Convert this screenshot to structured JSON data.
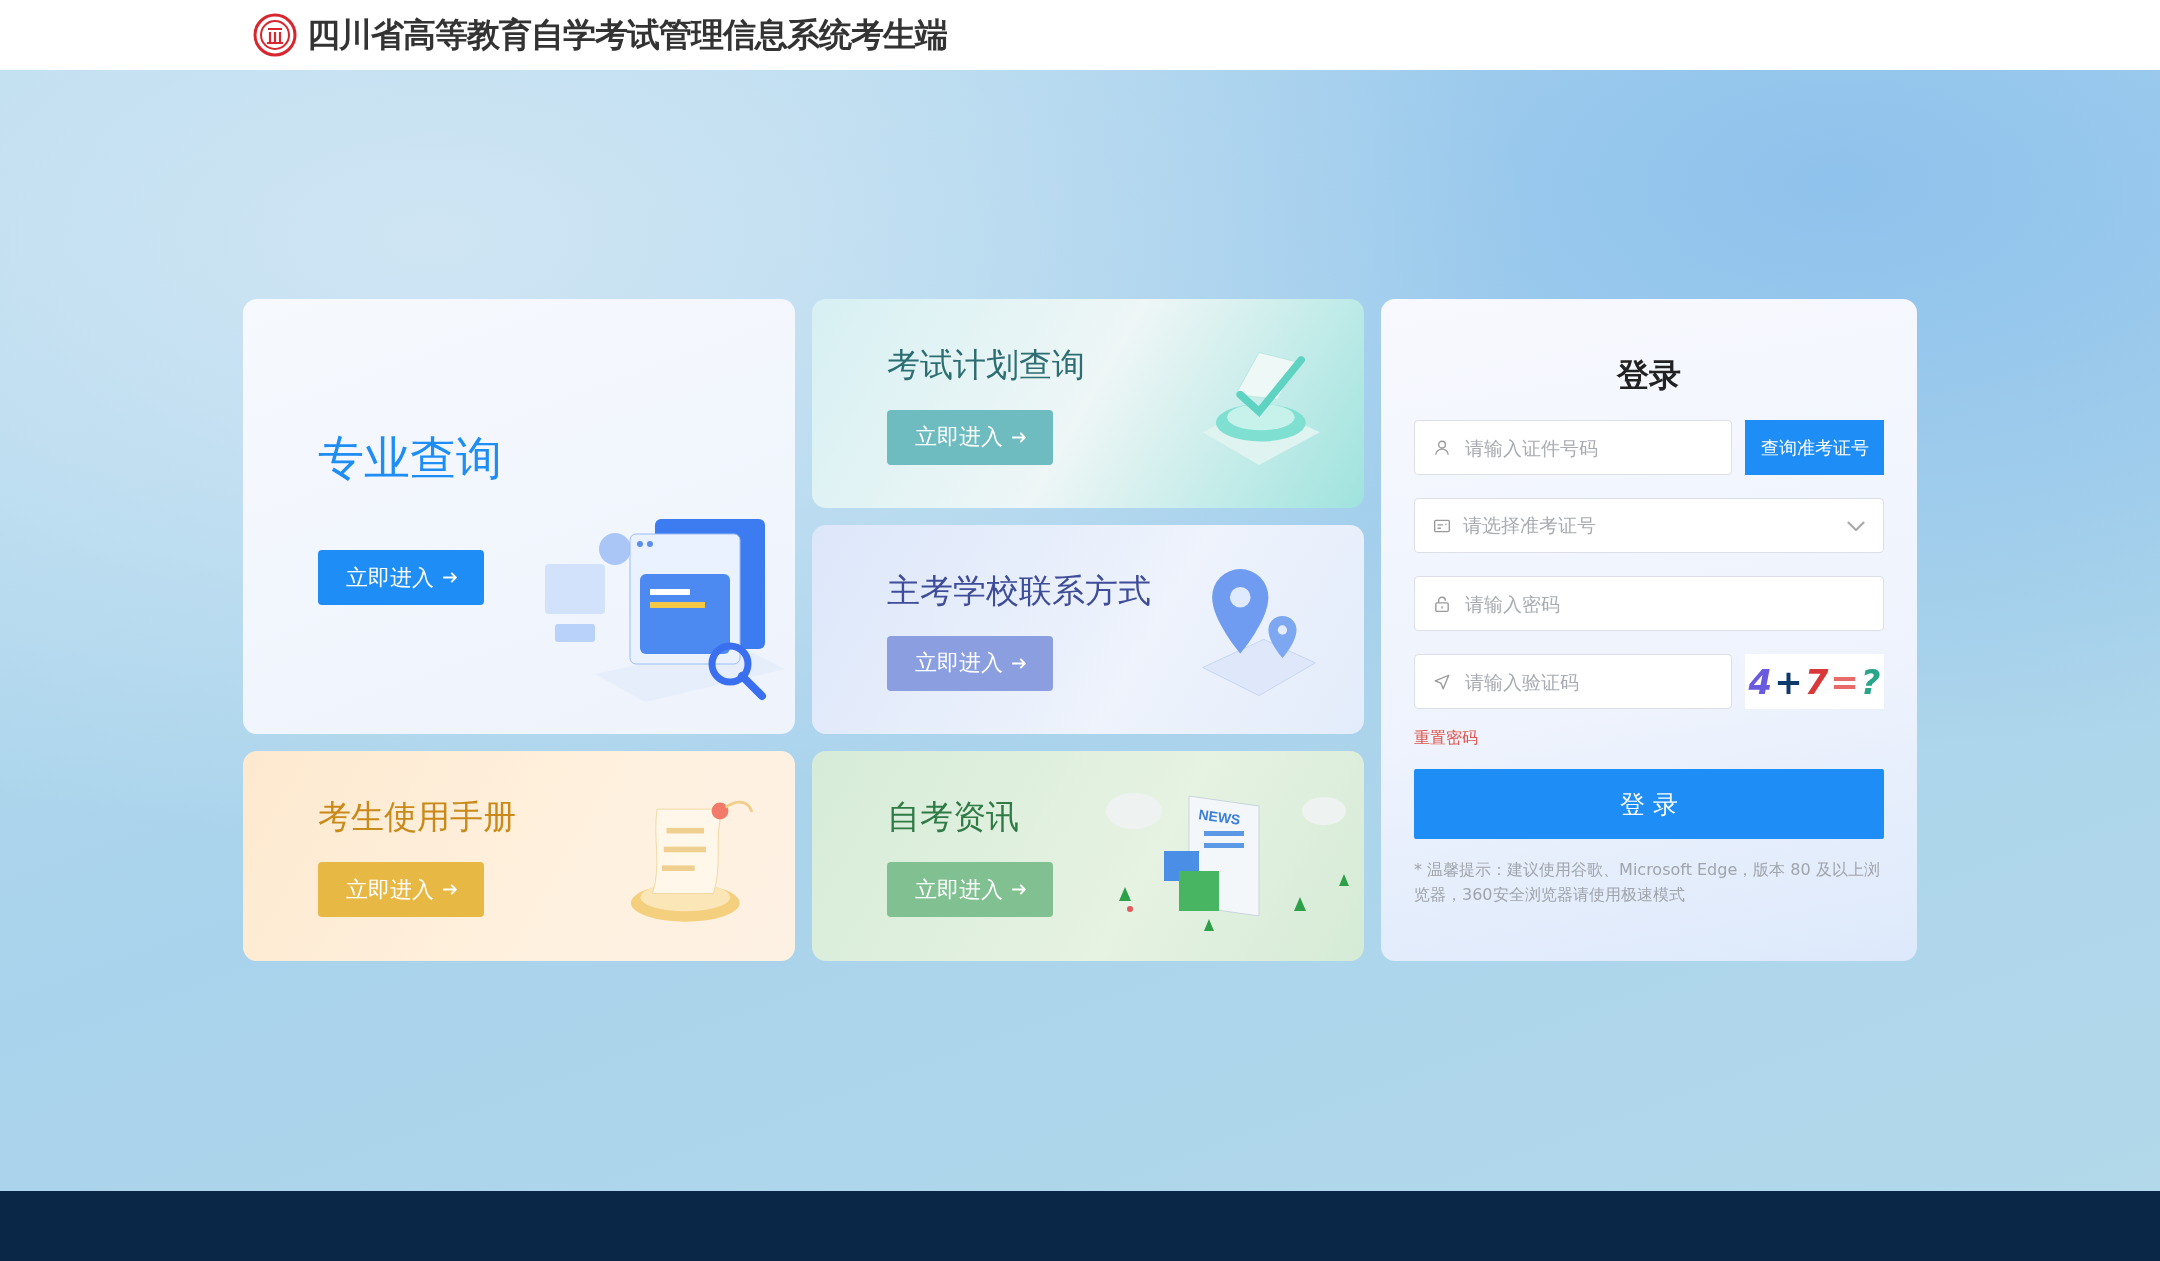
{
  "header": {
    "title": "四川省高等教育自学考试管理信息系统考生端"
  },
  "cards": [
    {
      "kind": "documents",
      "title": "专业查询",
      "button": "立即进入",
      "color": "#1e8df5"
    },
    {
      "kind": "book",
      "title": "考试计划查询",
      "button": "立即进入",
      "color": "#6fbcc0"
    },
    {
      "kind": "map",
      "title": "主考学校联系方式",
      "button": "立即进入",
      "color": "#8a9ee0"
    },
    {
      "kind": "manual",
      "title": "考生使用手册",
      "button": "立即进入",
      "color": "#e8b844"
    },
    {
      "kind": "news",
      "title": "自考资讯",
      "button": "立即进入",
      "color": "#80c091",
      "art_text": "NEWS"
    }
  ],
  "login": {
    "title": "登录",
    "fields": [
      {
        "kind": "id",
        "placeholder": "请输入证件号码",
        "button": "查询准考证号"
      },
      {
        "kind": "select",
        "placeholder": "请选择准考证号"
      },
      {
        "kind": "password",
        "placeholder": "请输入密码"
      },
      {
        "kind": "captcha",
        "placeholder": "请输入验证码",
        "captcha": "4+7=?"
      }
    ],
    "reset_link": "重置密码",
    "submit": "登 录",
    "hint": "* 温馨提示：建议使用谷歌、Microsoft Edge，版本 80 及以上浏览器，360安全浏览器请使用极速模式"
  }
}
